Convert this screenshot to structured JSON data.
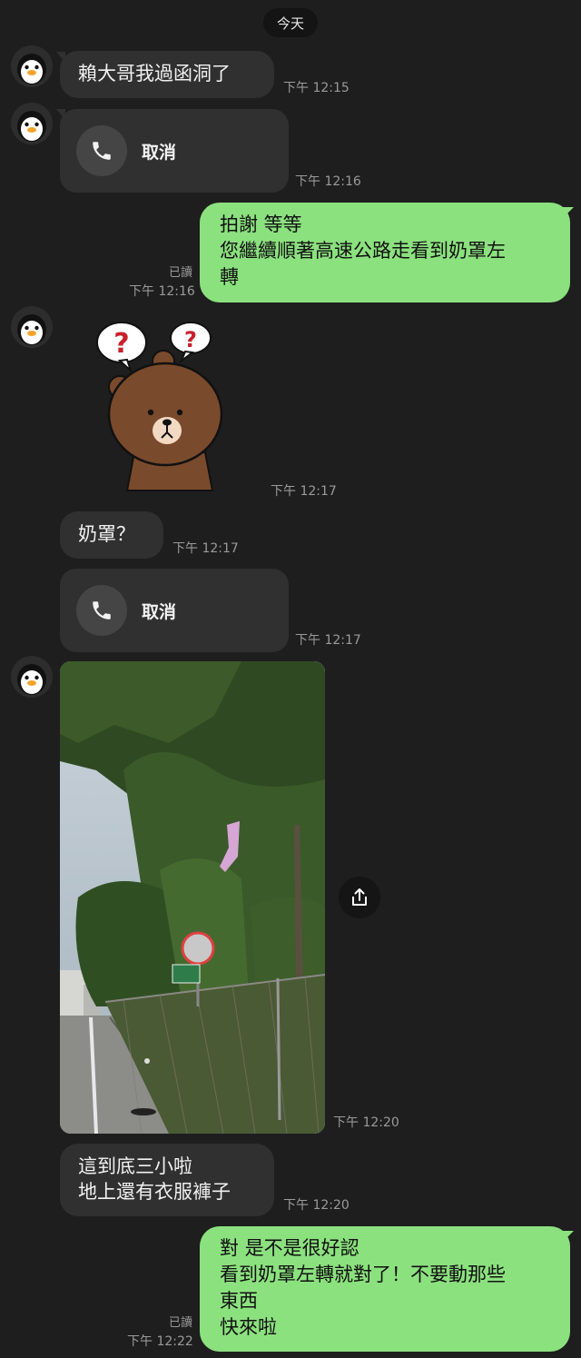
{
  "date_separator": "今天",
  "messages": [
    {
      "text": "賴大哥我過函洞了",
      "time": "下午 12:15"
    },
    {
      "call_label": "取消",
      "time": "下午 12:16"
    },
    {
      "lines": [
        "拍謝 等等",
        "您繼續順著高速公路走看到奶罩左",
        "轉"
      ],
      "read": "已讀",
      "time": "下午 12:16"
    },
    {
      "sticker": "brown-bear-confused",
      "time": "下午 12:17"
    },
    {
      "text": "奶罩？",
      "time": "下午 12:17"
    },
    {
      "call_label": "取消",
      "time": "下午 12:17"
    },
    {
      "photo": "roadside-trees-fence",
      "time": "下午 12:20"
    },
    {
      "lines": [
        "這到底三小啦",
        "地上還有衣服褲子"
      ],
      "time": "下午 12:20"
    },
    {
      "lines": [
        "對 是不是很好認",
        "看到奶罩左轉就對了！不要動那些",
        "東西",
        "快來啦"
      ],
      "read": "已讀",
      "time": "下午 12:22"
    }
  ],
  "colors": {
    "background": "#1e1e1e",
    "incoming_bubble": "#303030",
    "outgoing_bubble": "#8ce17f"
  },
  "icons": [
    "penguin-avatar",
    "phone-icon",
    "share-icon"
  ]
}
